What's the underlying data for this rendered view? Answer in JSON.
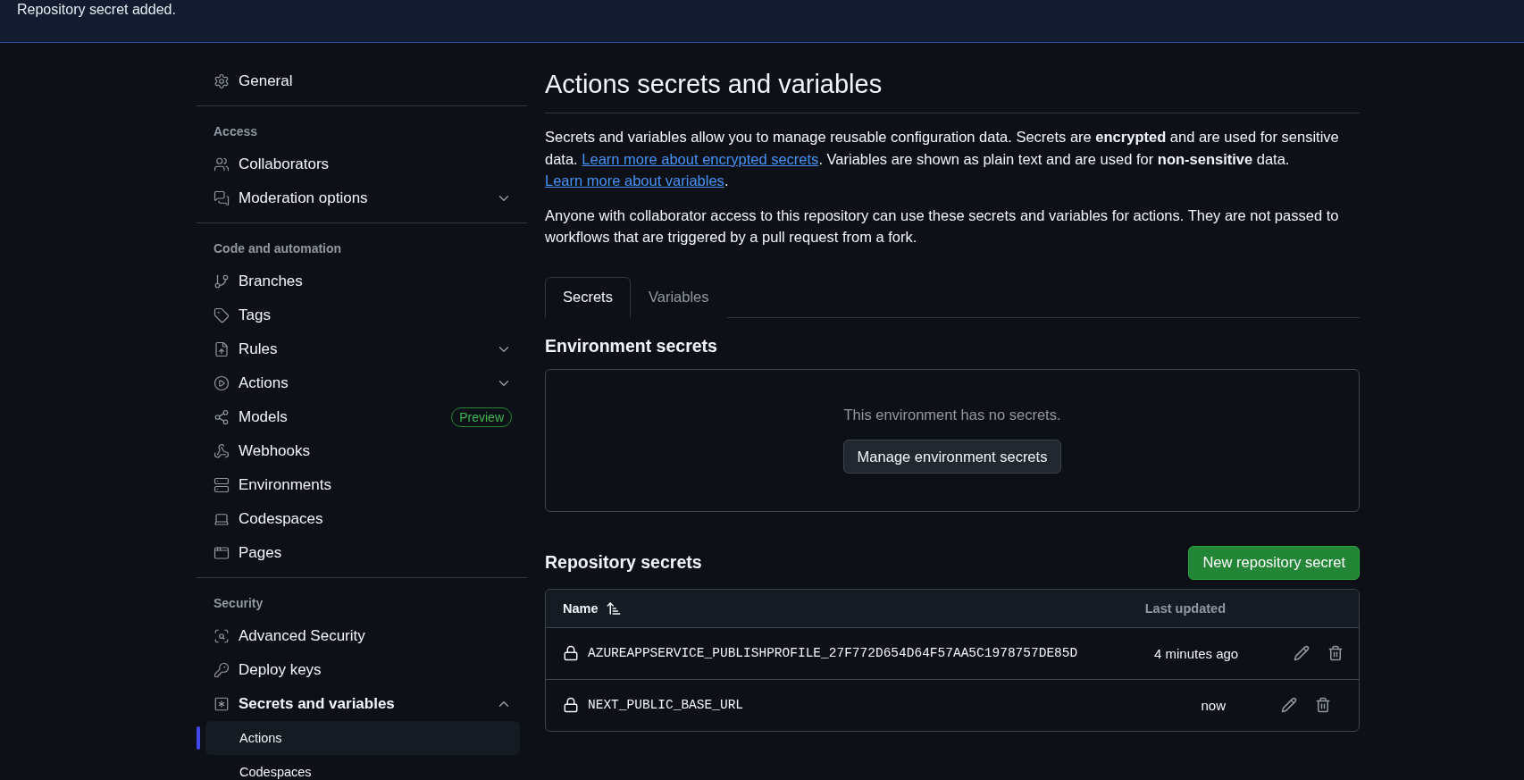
{
  "flash": {
    "message": "Repository secret added."
  },
  "sidebar": {
    "sections": [
      {
        "items": [
          {
            "label": "General"
          }
        ]
      },
      {
        "heading": "Access",
        "items": [
          {
            "label": "Collaborators"
          },
          {
            "label": "Moderation options",
            "expanded": false
          }
        ]
      },
      {
        "heading": "Code and automation",
        "items": [
          {
            "label": "Branches"
          },
          {
            "label": "Tags"
          },
          {
            "label": "Rules",
            "expanded": false
          },
          {
            "label": "Actions",
            "expanded": false
          },
          {
            "label": "Models",
            "badge": "Preview"
          },
          {
            "label": "Webhooks"
          },
          {
            "label": "Environments"
          },
          {
            "label": "Codespaces"
          },
          {
            "label": "Pages"
          }
        ]
      },
      {
        "heading": "Security",
        "items": [
          {
            "label": "Advanced Security"
          },
          {
            "label": "Deploy keys"
          },
          {
            "label": "Secrets and variables",
            "expanded": true,
            "children": [
              {
                "label": "Actions",
                "selected": true
              },
              {
                "label": "Codespaces",
                "selected": false
              }
            ]
          }
        ]
      }
    ]
  },
  "main": {
    "title": "Actions secrets and variables",
    "paragraphs": [
      [
        {
          "kind": "text",
          "text": "Secrets and variables allow you to manage reusable configuration data. Secrets are **encrypted** and are used for sensitive data. "
        },
        {
          "kind": "link",
          "text": "Learn more about encrypted secrets"
        },
        {
          "kind": "text",
          "text": ". Variables are shown as plain text and are used for **non-sensitive** data. "
        },
        {
          "kind": "link",
          "text": "Learn more about variables"
        },
        {
          "kind": "text",
          "text": "."
        }
      ],
      [
        {
          "kind": "text",
          "text": "Anyone with collaborator access to this repository can use these secrets and variables for actions. They are not passed to workflows that are triggered by a pull request from a fork."
        }
      ]
    ],
    "tabs": [
      {
        "label": "Secrets",
        "selected": true
      },
      {
        "label": "Variables",
        "selected": false
      }
    ],
    "environment_secrets": {
      "heading": "Environment secrets",
      "empty_message": "This environment has no secrets.",
      "button": "Manage environment secrets"
    },
    "repository_secrets": {
      "heading": "Repository secrets",
      "button": "New repository secret",
      "columns": [
        "Name",
        "Last updated"
      ],
      "rows": [
        {
          "name": "AZUREAPPSERVICE_PUBLISHPROFILE_27F772D654D64F57AA5C1978757DE85D",
          "updated": "4 minutes ago"
        },
        {
          "name": "NEXT_PUBLIC_BASE_URL",
          "updated": "now"
        }
      ]
    }
  }
}
